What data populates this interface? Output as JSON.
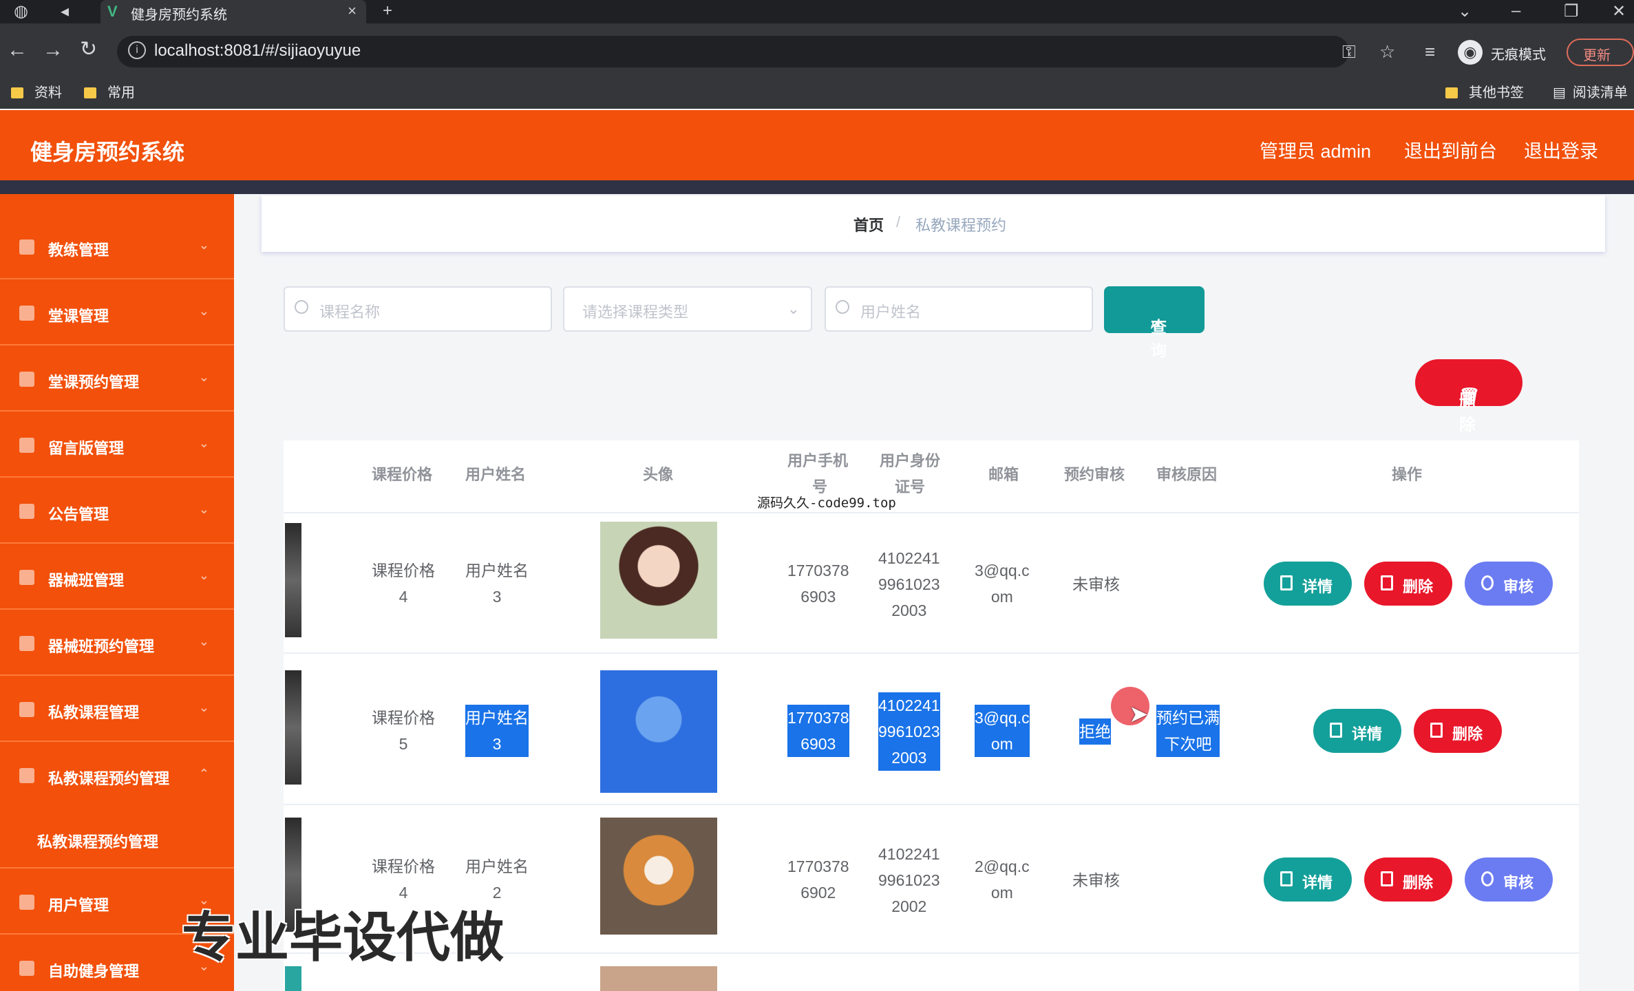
{
  "browser": {
    "tab_title": "健身房预约系统",
    "url": "localhost:8081/#/sijiaoyuyue",
    "incognito_label": "无痕模式",
    "update_label": "更新",
    "bookmarks": [
      "资料",
      "常用",
      "其他书签",
      "阅读清单"
    ]
  },
  "header": {
    "title": "健身房预约系统",
    "admin": "管理员 admin",
    "to_front": "退出到前台",
    "logout": "退出登录"
  },
  "sidebar": {
    "items": [
      {
        "label": "教练管理"
      },
      {
        "label": "堂课管理"
      },
      {
        "label": "堂课预约管理"
      },
      {
        "label": "留言版管理"
      },
      {
        "label": "公告管理"
      },
      {
        "label": "器械班管理"
      },
      {
        "label": "器械班预约管理"
      },
      {
        "label": "私教课程管理"
      },
      {
        "label": "私教课程预约管理"
      },
      {
        "label": "用户管理"
      },
      {
        "label": "自助健身管理"
      }
    ],
    "submenu": "私教课程预约管理"
  },
  "breadcrumb": {
    "home": "首页",
    "sep": "/",
    "current": "私教课程预约"
  },
  "search": {
    "course_name_placeholder": "课程名称",
    "course_type_placeholder": "请选择课程类型",
    "user_name_placeholder": "用户姓名",
    "query_label": "查询"
  },
  "top_delete_label": "删除",
  "table": {
    "headers": {
      "price": "课程价格",
      "username": "用户姓名",
      "avatar": "头像",
      "phone_l1": "用户手机",
      "phone_l2": "号",
      "idcard_l1": "用户身份",
      "idcard_l2": "证号",
      "email": "邮箱",
      "review": "预约审核",
      "reason": "审核原因",
      "ops": "操作"
    },
    "rows": [
      {
        "price_l1": "课程价格",
        "price_l2": "4",
        "name_l1": "用户姓名",
        "name_l2": "3",
        "phone_l1": "1770378",
        "phone_l2": "6903",
        "id_l1": "4102241",
        "id_l2": "9961023",
        "id_l3": "2003",
        "email_l1": "3@qq.c",
        "email_l2": "om",
        "review": "未审核",
        "reason_l1": "",
        "reason_l2": ""
      },
      {
        "price_l1": "课程价格",
        "price_l2": "5",
        "name_l1": "用户姓名",
        "name_l2": "3",
        "phone_l1": "1770378",
        "phone_l2": "6903",
        "id_l1": "4102241",
        "id_l2": "9961023",
        "id_l3": "2003",
        "email_l1": "3@qq.c",
        "email_l2": "om",
        "review": "拒绝",
        "reason_l1": "预约已满",
        "reason_l2": "下次吧"
      },
      {
        "price_l1": "课程价格",
        "price_l2": "4",
        "name_l1": "用户姓名",
        "name_l2": "2",
        "phone_l1": "1770378",
        "phone_l2": "6902",
        "id_l1": "4102241",
        "id_l2": "9961023",
        "id_l3": "2002",
        "email_l1": "2@qq.c",
        "email_l2": "om",
        "review": "未审核",
        "reason_l1": "",
        "reason_l2": ""
      }
    ],
    "actions": {
      "detail": "详情",
      "delete": "删除",
      "review": "审核"
    }
  },
  "overlay": {
    "site_tag": "源码久久-code99.top",
    "banner": "专业毕设代做"
  },
  "colors": {
    "brand": "#f2500b",
    "teal": "#14a09a",
    "red": "#e8172a",
    "blue": "#6b7cf2"
  }
}
